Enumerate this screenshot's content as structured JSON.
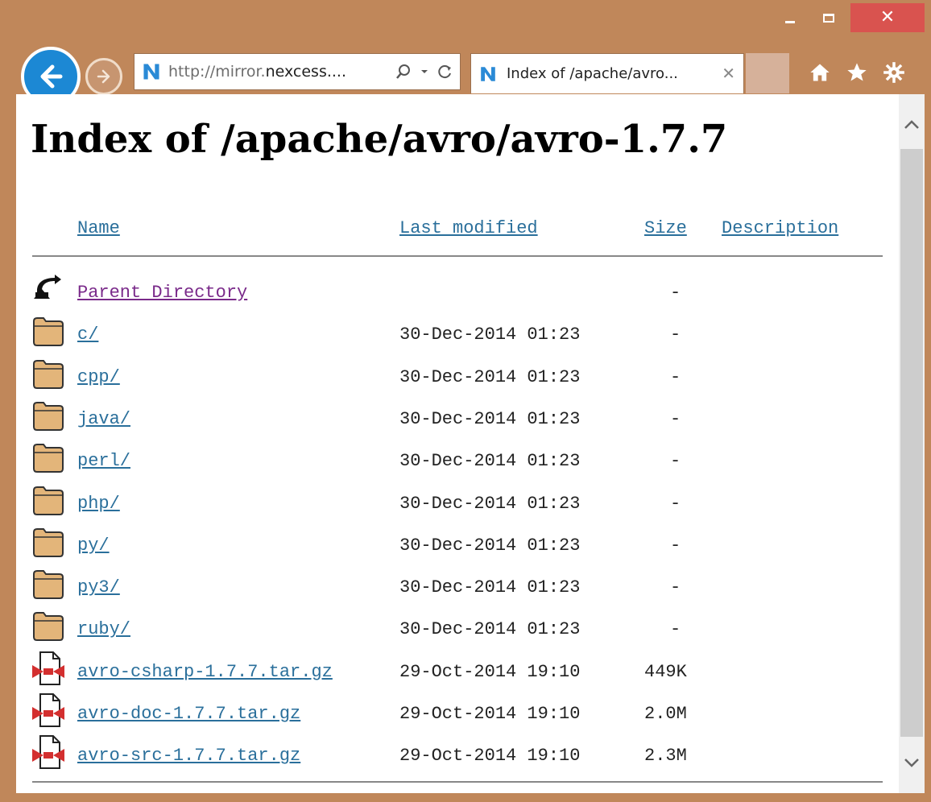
{
  "window": {
    "minimize": "–",
    "maximize": "",
    "close": "✕"
  },
  "address_bar": {
    "url_prefix": "http://mirror.",
    "url_domain": "nexcess....",
    "search_icon": "search-icon",
    "dropdown_icon": "chevron-down-icon",
    "refresh_icon": "refresh-icon"
  },
  "tab": {
    "title": "Index of /apache/avro...",
    "close": "✕"
  },
  "page": {
    "title": "Index of /apache/avro/avro-1.7.7",
    "columns": {
      "name": "Name",
      "last_modified": "Last modified",
      "size": "Size",
      "description": "Description"
    },
    "rows": [
      {
        "icon": "back-icon",
        "name": "Parent Directory",
        "date": "",
        "size": "-"
      },
      {
        "icon": "folder-icon",
        "name": "c/",
        "date": "30-Dec-2014 01:23",
        "size": "-"
      },
      {
        "icon": "folder-icon",
        "name": "cpp/",
        "date": "30-Dec-2014 01:23",
        "size": "-"
      },
      {
        "icon": "folder-icon",
        "name": "java/",
        "date": "30-Dec-2014 01:23",
        "size": "-"
      },
      {
        "icon": "folder-icon",
        "name": "perl/",
        "date": "30-Dec-2014 01:23",
        "size": "-"
      },
      {
        "icon": "folder-icon",
        "name": "php/",
        "date": "30-Dec-2014 01:23",
        "size": "-"
      },
      {
        "icon": "folder-icon",
        "name": "py/",
        "date": "30-Dec-2014 01:23",
        "size": "-"
      },
      {
        "icon": "folder-icon",
        "name": "py3/",
        "date": "30-Dec-2014 01:23",
        "size": "-"
      },
      {
        "icon": "folder-icon",
        "name": "ruby/",
        "date": "30-Dec-2014 01:23",
        "size": "-"
      },
      {
        "icon": "archive-icon",
        "name": "avro-csharp-1.7.7.tar.gz",
        "date": "29-Oct-2014 19:10",
        "size": "449K"
      },
      {
        "icon": "archive-icon",
        "name": "avro-doc-1.7.7.tar.gz",
        "date": "29-Oct-2014 19:10",
        "size": "2.0M"
      },
      {
        "icon": "archive-icon",
        "name": "avro-src-1.7.7.tar.gz",
        "date": "29-Oct-2014 19:10",
        "size": "2.3M"
      }
    ]
  },
  "colors": {
    "frame": "#c0875a",
    "link": "#2a6f9b",
    "visited_link": "#7a2a8a",
    "back_button": "#1c88d4",
    "close_button": "#d9534f"
  }
}
